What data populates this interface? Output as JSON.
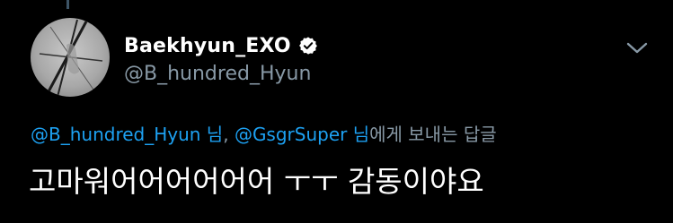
{
  "user": {
    "display_name": "Baekhyun_EXO",
    "handle": "@B_hundred_Hyun",
    "verified": true
  },
  "reply_to": {
    "mention_1": "@B_hundred_Hyun 님",
    "separator": ", ",
    "mention_2": "@GsgrSuper 님",
    "suffix": "에게 보내는 답글"
  },
  "tweet": {
    "text": "고마워어어어어어어 ㅜㅜ 감동이야요"
  },
  "icons": {
    "verified": "verified-badge-icon",
    "caret": "chevron-down-icon",
    "avatar": "avatar"
  },
  "colors": {
    "background": "#000000",
    "text": "#ffffff",
    "secondary": "#8899a6",
    "link": "#1da1f2",
    "thread_line": "#3d5466"
  }
}
